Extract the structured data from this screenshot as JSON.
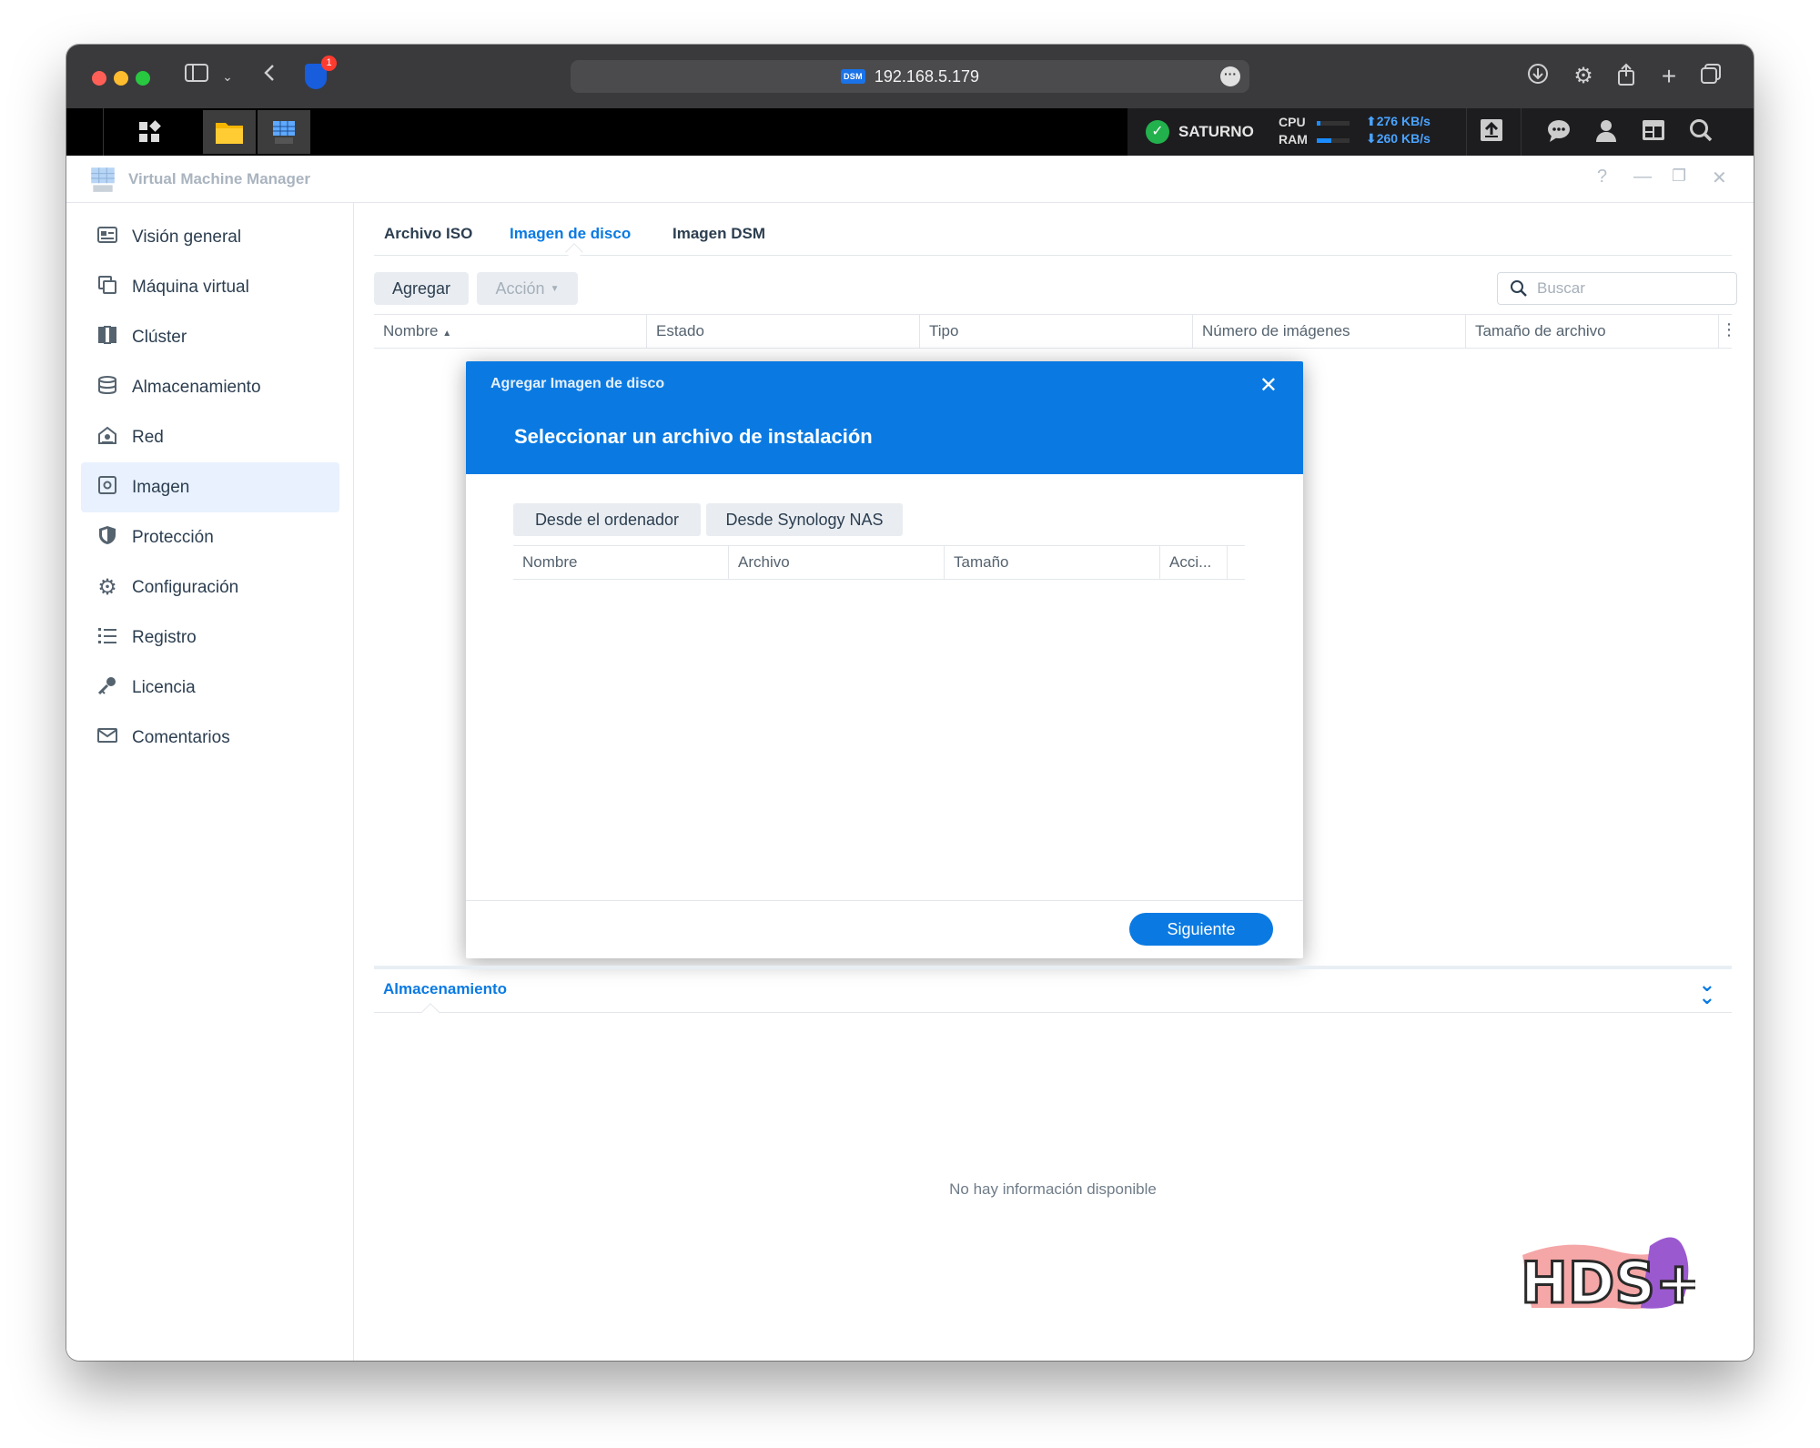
{
  "browser": {
    "url": "192.168.5.179",
    "url_badge": "DSM",
    "bitwarden_badge": "1"
  },
  "taskbar": {
    "server_name": "SATURNO",
    "cpu_label": "CPU",
    "ram_label": "RAM",
    "cpu_level": 0.1,
    "ram_level": 0.45,
    "upload": "276 KB/s",
    "download": "260 KB/s"
  },
  "app": {
    "title": "Virtual Machine Manager"
  },
  "sidebar": {
    "items": [
      {
        "label": "Visión general",
        "icon": "overview-icon"
      },
      {
        "label": "Máquina virtual",
        "icon": "virtual-machine-icon"
      },
      {
        "label": "Clúster",
        "icon": "cluster-icon"
      },
      {
        "label": "Almacenamiento",
        "icon": "storage-icon"
      },
      {
        "label": "Red",
        "icon": "network-icon"
      },
      {
        "label": "Imagen",
        "icon": "image-icon"
      },
      {
        "label": "Protección",
        "icon": "shield-icon"
      },
      {
        "label": "Configuración",
        "icon": "gear-icon"
      },
      {
        "label": "Registro",
        "icon": "log-icon"
      },
      {
        "label": "Licencia",
        "icon": "key-icon"
      },
      {
        "label": "Comentarios",
        "icon": "mail-icon"
      }
    ],
    "selected": "Imagen"
  },
  "main": {
    "tabs": [
      "Archivo ISO",
      "Imagen de disco",
      "Imagen DSM"
    ],
    "active_tab": "Imagen de disco",
    "toolbar": {
      "add": "Agregar",
      "action": "Acción"
    },
    "search_placeholder": "Buscar",
    "columns": [
      "Nombre",
      "Estado",
      "Tipo",
      "Número de imágenes",
      "Tamaño de archivo"
    ]
  },
  "modal": {
    "title": "Agregar Imagen de disco",
    "heading": "Seleccionar un archivo de instalación",
    "from_computer": "Desde el ordenador",
    "from_nas": "Desde Synology NAS",
    "columns": [
      "Nombre",
      "Archivo",
      "Tamaño",
      "Acci..."
    ],
    "next": "Siguiente"
  },
  "bottom_panel": {
    "tab": "Almacenamiento",
    "empty": "No hay información disponible"
  },
  "logo": {
    "text": "HDS+"
  },
  "colors": {
    "accent": "#0a7ae2",
    "taskbar": "#000000",
    "toolbar": "#3a3a3c",
    "status_ok": "#22b14c"
  }
}
